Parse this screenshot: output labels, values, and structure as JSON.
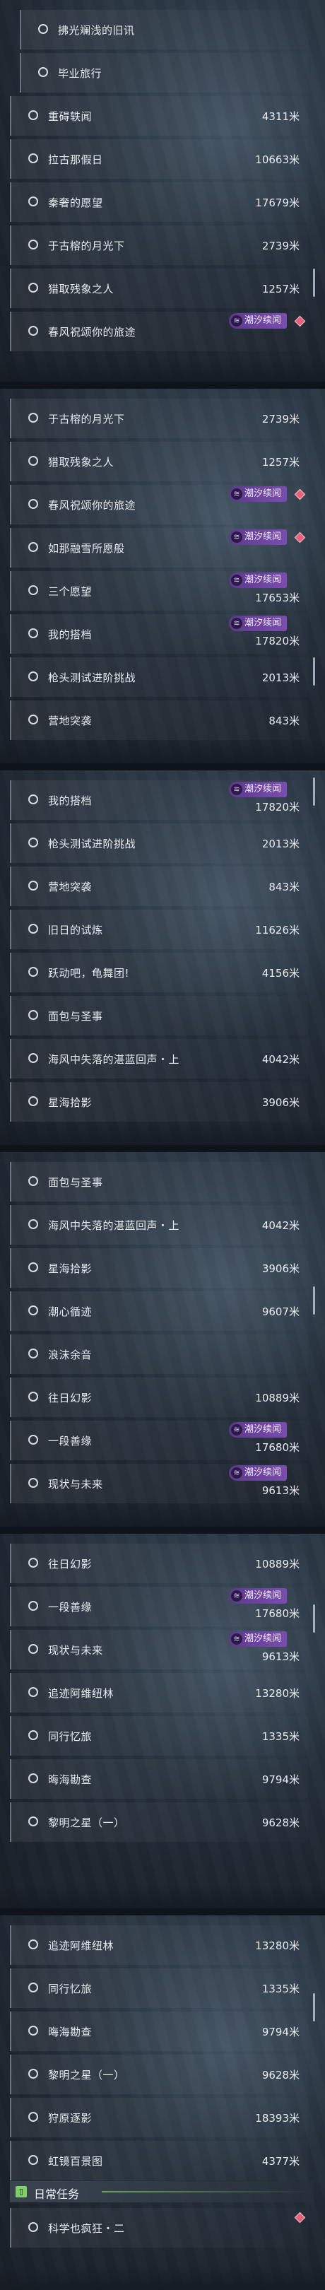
{
  "tag_label": "潮汐续闻",
  "accent_colors": {
    "tag": "#7a4db0",
    "daily": "#7fd067",
    "marker": "#e8607a"
  },
  "panels": [
    {
      "rows": [
        {
          "label": "拂光斓浅的旧讯",
          "distance": "",
          "sub": true,
          "tag": false,
          "marker": false
        },
        {
          "label": "毕业旅行",
          "distance": "",
          "sub": true,
          "tag": false,
          "marker": false
        },
        {
          "label": "重碍轶闻",
          "distance": "4311米",
          "sub": false,
          "tag": false,
          "marker": false
        },
        {
          "label": "拉古那假日",
          "distance": "10663米",
          "sub": false,
          "tag": false,
          "marker": false
        },
        {
          "label": "秦奢的愿望",
          "distance": "17679米",
          "sub": false,
          "tag": false,
          "marker": false
        },
        {
          "label": "于古榕的月光下",
          "distance": "2739米",
          "sub": false,
          "tag": false,
          "marker": false
        },
        {
          "label": "猎取残象之人",
          "distance": "1257米",
          "sub": false,
          "tag": false,
          "marker": false
        },
        {
          "label": "春风祝颂你的旅途",
          "distance": "",
          "sub": false,
          "tag": true,
          "marker": true
        }
      ]
    },
    {
      "rows": [
        {
          "label": "于古榕的月光下",
          "distance": "2739米",
          "sub": false,
          "tag": false,
          "marker": false
        },
        {
          "label": "猎取残象之人",
          "distance": "1257米",
          "sub": false,
          "tag": false,
          "marker": false
        },
        {
          "label": "春风祝颂你的旅途",
          "distance": "",
          "sub": false,
          "tag": true,
          "marker": true
        },
        {
          "label": "如那融雪所愿般",
          "distance": "",
          "sub": false,
          "tag": true,
          "marker": true
        },
        {
          "label": "三个愿望",
          "distance": "17653米",
          "sub": false,
          "tag": true,
          "marker": false
        },
        {
          "label": "我的搭档",
          "distance": "17820米",
          "sub": false,
          "tag": true,
          "marker": false
        },
        {
          "label": "枪头测试进阶挑战",
          "distance": "2013米",
          "sub": false,
          "tag": false,
          "marker": false
        },
        {
          "label": "营地突袭",
          "distance": "843米",
          "sub": false,
          "tag": false,
          "marker": false
        }
      ]
    },
    {
      "rows": [
        {
          "label": "我的搭档",
          "distance": "17820米",
          "sub": false,
          "tag": true,
          "marker": false
        },
        {
          "label": "枪头测试进阶挑战",
          "distance": "2013米",
          "sub": false,
          "tag": false,
          "marker": false
        },
        {
          "label": "营地突袭",
          "distance": "843米",
          "sub": false,
          "tag": false,
          "marker": false
        },
        {
          "label": "旧日的试炼",
          "distance": "11626米",
          "sub": false,
          "tag": false,
          "marker": false
        },
        {
          "label": "跃动吧，龟舞团!",
          "distance": "4156米",
          "sub": false,
          "tag": false,
          "marker": false
        },
        {
          "label": "面包与圣事",
          "distance": "",
          "sub": false,
          "tag": false,
          "marker": false
        },
        {
          "label": "海风中失落的湛蓝回声・上",
          "distance": "4042米",
          "sub": false,
          "tag": false,
          "marker": false
        },
        {
          "label": "星海拾影",
          "distance": "3906米",
          "sub": false,
          "tag": false,
          "marker": false
        }
      ]
    },
    {
      "rows": [
        {
          "label": "面包与圣事",
          "distance": "",
          "sub": false,
          "tag": false,
          "marker": false
        },
        {
          "label": "海风中失落的湛蓝回声・上",
          "distance": "4042米",
          "sub": false,
          "tag": false,
          "marker": false
        },
        {
          "label": "星海拾影",
          "distance": "3906米",
          "sub": false,
          "tag": false,
          "marker": false
        },
        {
          "label": "潮心循迹",
          "distance": "9607米",
          "sub": false,
          "tag": false,
          "marker": false
        },
        {
          "label": "浪沫余音",
          "distance": "",
          "sub": false,
          "tag": false,
          "marker": false
        },
        {
          "label": "往日幻影",
          "distance": "10889米",
          "sub": false,
          "tag": false,
          "marker": false
        },
        {
          "label": "一段善缘",
          "distance": "17680米",
          "sub": false,
          "tag": true,
          "marker": false
        },
        {
          "label": "现状与未来",
          "distance": "9613米",
          "sub": false,
          "tag": true,
          "marker": false
        }
      ]
    },
    {
      "rows": [
        {
          "label": "往日幻影",
          "distance": "10889米",
          "sub": false,
          "tag": false,
          "marker": false
        },
        {
          "label": "一段善缘",
          "distance": "17680米",
          "sub": false,
          "tag": true,
          "marker": false
        },
        {
          "label": "现状与未来",
          "distance": "9613米",
          "sub": false,
          "tag": true,
          "marker": false
        },
        {
          "label": "追迹阿维纽林",
          "distance": "13280米",
          "sub": false,
          "tag": false,
          "marker": false
        },
        {
          "label": "同行忆旅",
          "distance": "1335米",
          "sub": false,
          "tag": false,
          "marker": false
        },
        {
          "label": "晦海勘查",
          "distance": "9794米",
          "sub": false,
          "tag": false,
          "marker": false
        },
        {
          "label": "黎明之星（一）",
          "distance": "9628米",
          "sub": false,
          "tag": false,
          "marker": false
        }
      ]
    },
    {
      "rows": [
        {
          "label": "追迹阿维纽林",
          "distance": "13280米",
          "sub": false,
          "tag": false,
          "marker": false
        },
        {
          "label": "同行忆旅",
          "distance": "1335米",
          "sub": false,
          "tag": false,
          "marker": false
        },
        {
          "label": "晦海勘查",
          "distance": "9794米",
          "sub": false,
          "tag": false,
          "marker": false
        },
        {
          "label": "黎明之星（一）",
          "distance": "9628米",
          "sub": false,
          "tag": false,
          "marker": false
        },
        {
          "label": "狩原逐影",
          "distance": "18393米",
          "sub": false,
          "tag": false,
          "marker": false
        },
        {
          "label": "虹镜百景图",
          "distance": "4377米",
          "sub": false,
          "tag": false,
          "marker": false
        }
      ],
      "daily": {
        "title": "日常任务",
        "icon": "book-icon"
      },
      "after_daily": [
        {
          "label": "科学也疯狂・二",
          "distance": "",
          "sub": false,
          "tag": false,
          "marker": true
        }
      ]
    }
  ]
}
